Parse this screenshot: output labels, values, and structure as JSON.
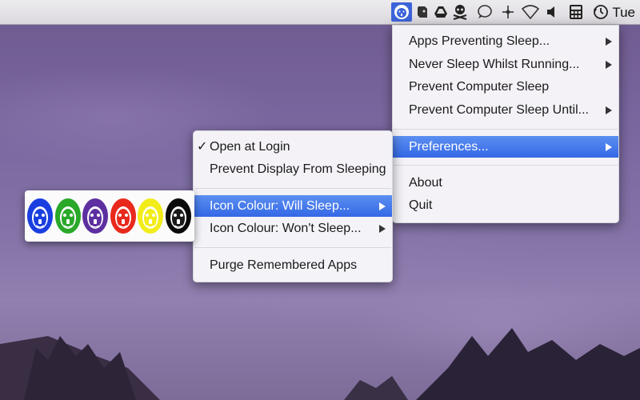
{
  "menubar": {
    "clock": "Tue",
    "status_icons": [
      "lion-icon",
      "evernote-icon",
      "drive-icon",
      "skull-icon",
      "chat-bubble-icon",
      "move-icon",
      "wifi-icon",
      "volume-icon",
      "calculator-icon",
      "time-machine-icon"
    ]
  },
  "main_menu": {
    "items": [
      {
        "label": "Apps Preventing Sleep...",
        "submenu": true
      },
      {
        "label": "Never Sleep Whilst Running...",
        "submenu": true
      },
      {
        "label": "Prevent Computer Sleep",
        "submenu": false
      },
      {
        "label": "Prevent Computer Sleep Until...",
        "submenu": true
      },
      {
        "label": "Preferences...",
        "submenu": true,
        "highlighted": true
      },
      {
        "label": "About",
        "submenu": false
      },
      {
        "label": "Quit",
        "submenu": false
      }
    ]
  },
  "sub_menu": {
    "items": [
      {
        "label": "Open at Login",
        "checked": true,
        "check_mark": "✓"
      },
      {
        "label": "Prevent Display From Sleeping"
      },
      {
        "label": "Icon Colour: Will Sleep...",
        "submenu": true,
        "highlighted": true
      },
      {
        "label": "Icon Colour: Won't Sleep...",
        "submenu": true
      },
      {
        "label": "Purge Remembered Apps"
      }
    ]
  },
  "palette": {
    "colors": [
      "#1a3fe0",
      "#2aa829",
      "#5d2fa0",
      "#e8291c",
      "#f2ec1a",
      "#0a0a0a"
    ]
  },
  "colors": {
    "highlight": "#3468e6",
    "menu_bg": "#f8f7fa"
  }
}
